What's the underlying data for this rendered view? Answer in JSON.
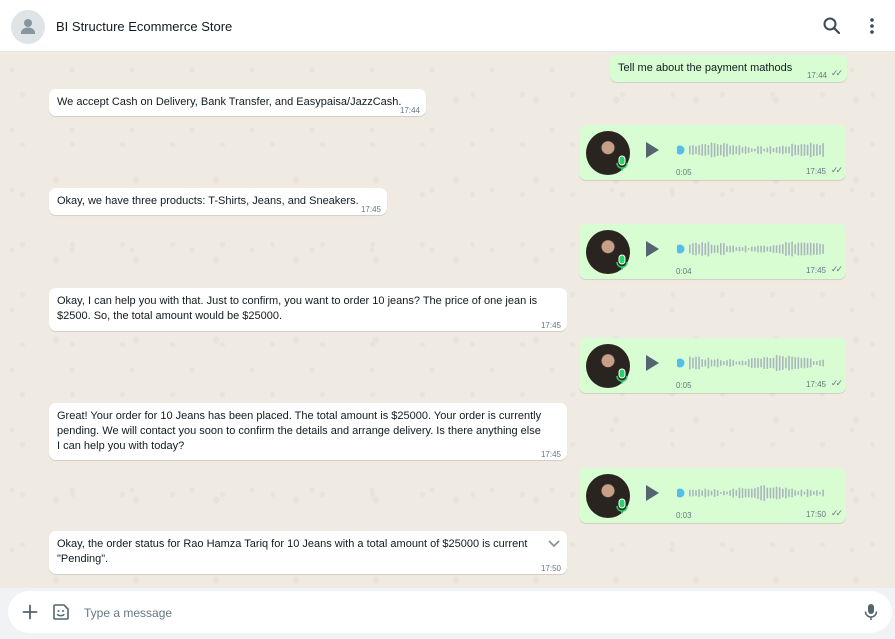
{
  "header": {
    "title": "BI Structure Ecommerce Store",
    "icons": [
      "person-icon",
      "search-icon",
      "kebab-menu-icon"
    ]
  },
  "messages": [
    {
      "direction": "out",
      "type": "text",
      "text": "Tell me about the payment mathods",
      "time": "17:44",
      "status": "read"
    },
    {
      "direction": "in",
      "type": "text",
      "text": "We accept Cash on Delivery, Bank Transfer, and Easypaisa/JazzCash.",
      "time": "17:44"
    },
    {
      "direction": "out",
      "type": "voice",
      "duration": "0:05",
      "time": "17:45",
      "status": "read"
    },
    {
      "direction": "in",
      "type": "text",
      "text": "Okay, we have three products: T-Shirts, Jeans, and Sneakers.",
      "time": "17:45"
    },
    {
      "direction": "out",
      "type": "voice",
      "duration": "0:04",
      "time": "17:45",
      "status": "read"
    },
    {
      "direction": "in",
      "type": "text",
      "text": "Okay, I can help you with that. Just to confirm, you want to order 10 jeans? The price of one jean is\n$2500. So, the total amount would be $25000.",
      "time": "17:45"
    },
    {
      "direction": "out",
      "type": "voice",
      "duration": "0:05",
      "time": "17:45",
      "status": "read"
    },
    {
      "direction": "in",
      "type": "text",
      "text": "Great! Your order for 10 Jeans has been placed. The total amount is $25000. Your order is currently\npending. We will contact you soon to confirm the details and arrange delivery. Is there anything else\nI can help you with today?",
      "time": "17:45"
    },
    {
      "direction": "out",
      "type": "voice",
      "duration": "0:03",
      "time": "17:50",
      "status": "read"
    },
    {
      "direction": "in",
      "type": "text",
      "text": "Okay, the order status for Rao Hamza Tariq for 10 Jeans with a total amount of $25000 is current\n\"Pending\".",
      "time": "17:50"
    }
  ],
  "composer": {
    "placeholder": "Type a message",
    "icons": [
      "plus-icon",
      "sticker-icon",
      "mic-icon"
    ]
  },
  "colors": {
    "incoming_bubble": "#ffffff",
    "outgoing_bubble": "#d9fdd3",
    "chat_background": "#efeae2",
    "play_accent": "#53bdeb"
  }
}
